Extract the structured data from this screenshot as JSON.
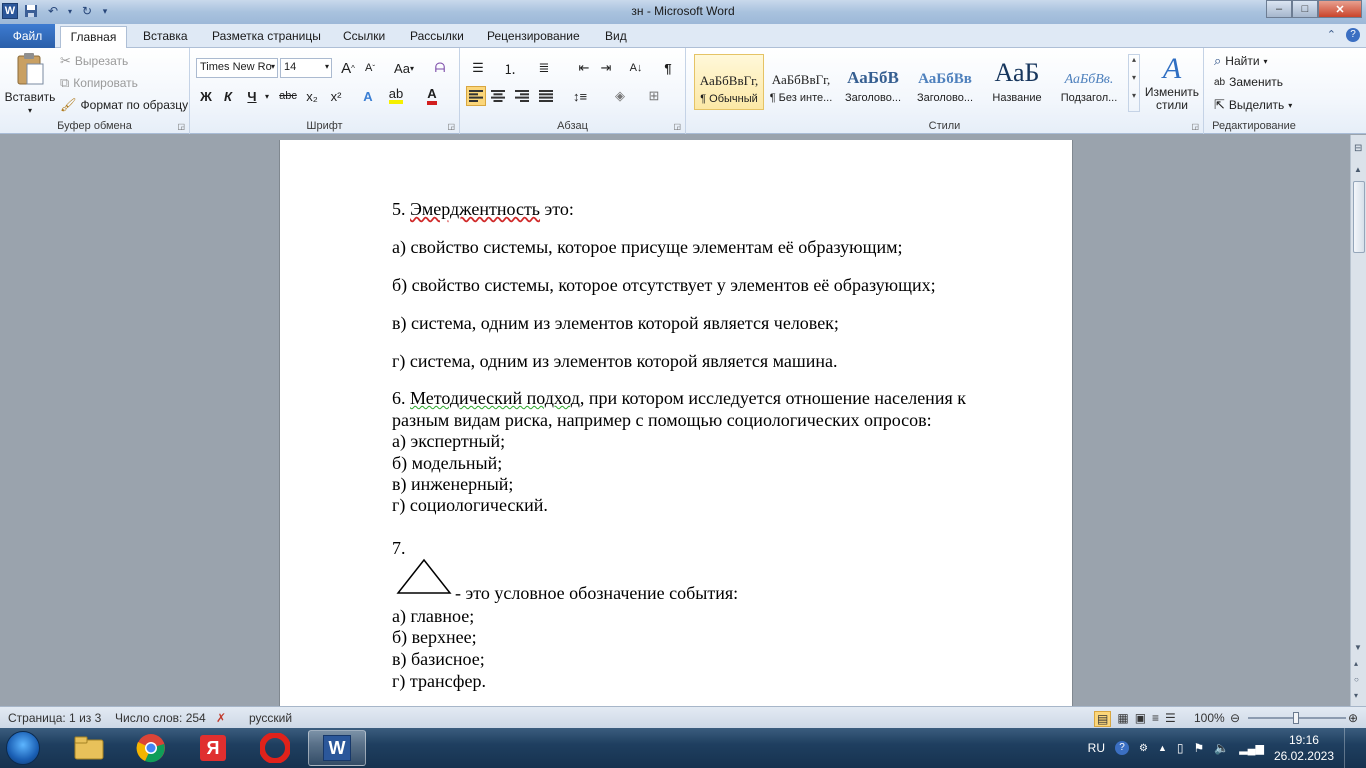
{
  "window": {
    "title": "зн  -  Microsoft Word",
    "controls": {
      "minimize": "–",
      "maximize": "□",
      "close": "✕"
    }
  },
  "tabs": [
    "Файл",
    "Главная",
    "Вставка",
    "Разметка страницы",
    "Ссылки",
    "Рассылки",
    "Рецензирование",
    "Вид"
  ],
  "ribbon": {
    "clipboard": {
      "paste": "Вставить",
      "cut": "Вырезать",
      "copy": "Копировать",
      "format_painter": "Формат по образцу",
      "label": "Буфер обмена"
    },
    "font": {
      "name": "Times New Ro",
      "size": "14",
      "bold": "Ж",
      "italic": "К",
      "underline": "Ч",
      "strike": "abc",
      "sub": "x₂",
      "sup": "x²",
      "grow": "A",
      "shrink": "A",
      "case": "Aa",
      "label": "Шрифт"
    },
    "paragraph": {
      "label": "Абзац"
    },
    "styles": {
      "items": [
        {
          "sample": "АаБбВвГг,",
          "name": "¶ Обычный"
        },
        {
          "sample": "АаБбВвГг,",
          "name": "¶ Без инте..."
        },
        {
          "sample": "АаБбВ",
          "name": "Заголово..."
        },
        {
          "sample": "АаБбВв",
          "name": "Заголово..."
        },
        {
          "sample": "АаБ",
          "name": "Название"
        },
        {
          "sample": "АаБбВв.",
          "name": "Подзагол..."
        }
      ],
      "change_styles": "Изменить стили",
      "label": "Стили"
    },
    "editing": {
      "find": "Найти",
      "replace": "Заменить",
      "select": "Выделить",
      "label": "Редактирование"
    }
  },
  "document": {
    "q5_num": "5. ",
    "q5_word": "Эмерджентность",
    "q5_rest": " это:",
    "q5_a": "а) свойство системы, которое присуще элементам её образующим;",
    "q5_b": "б) свойство системы, которое отсутствует у элементов её образующих;",
    "q5_c": "в) система, одним из элементов которой является человек;",
    "q5_d": "г) система, одним из элементов которой является машина.",
    "q6_num": "6. ",
    "q6_word": "Методический подход",
    "q6_rest": ", при котором исследуется отношение населения к",
    "q6_line2": "разным видам риска, например с помощью социологических опросов:",
    "q6_a": "а) экспертный;",
    "q6_b": "б) модельный;",
    "q6_c": "в) инженерный;",
    "q6_d": "г) социологический.",
    "q7_num": "7.",
    "q7_text": "- это условное обозначение события:",
    "q7_a": "а) главное;",
    "q7_b": "б) верхнее;",
    "q7_c": "в) базисное;",
    "q7_d": "г) трансфер."
  },
  "statusbar": {
    "page": "Страница: 1 из 3",
    "words": "Число слов: 254",
    "language": "русский",
    "zoom": "100%"
  },
  "taskbar": {
    "lang": "RU",
    "time": "19:16",
    "date": "26.02.2023"
  }
}
